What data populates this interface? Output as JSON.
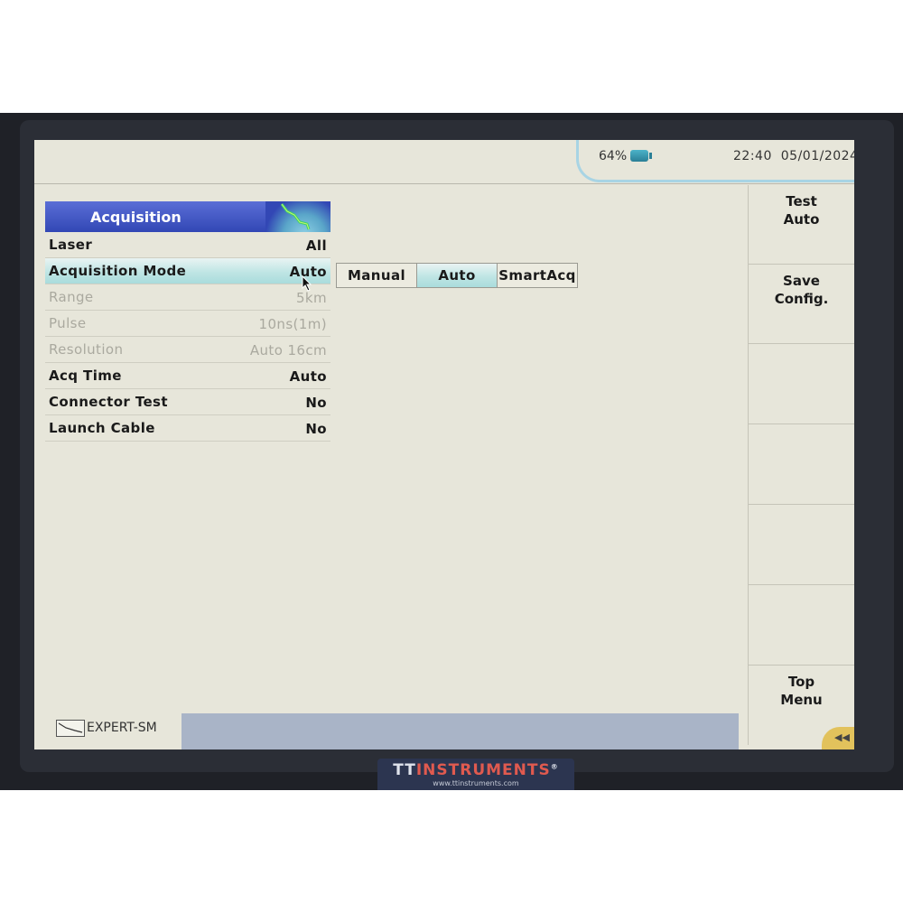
{
  "status": {
    "battery_percent": "64%",
    "time": "22:40",
    "date": "05/01/2024"
  },
  "menu": {
    "title": "Acquisition",
    "rows": [
      {
        "label": "Laser",
        "value": "All",
        "enabled": true,
        "selected": false
      },
      {
        "label": "Acquisition Mode",
        "value": "Auto",
        "enabled": true,
        "selected": true
      },
      {
        "label": "Range",
        "value": "5km",
        "enabled": false,
        "selected": false
      },
      {
        "label": "Pulse",
        "value": "10ns(1m)",
        "enabled": false,
        "selected": false
      },
      {
        "label": "Resolution",
        "value": "Auto 16cm",
        "enabled": false,
        "selected": false
      },
      {
        "label": "Acq Time",
        "value": "Auto",
        "enabled": true,
        "selected": false
      },
      {
        "label": "Connector Test",
        "value": "No",
        "enabled": true,
        "selected": false
      },
      {
        "label": "Launch Cable",
        "value": "No",
        "enabled": true,
        "selected": false
      }
    ]
  },
  "options": {
    "items": [
      "Manual",
      "Auto",
      "SmartAcq"
    ],
    "selected": "Auto"
  },
  "softkeys": {
    "test_line1": "Test",
    "test_line2": "Auto",
    "save_line1": "Save",
    "save_line2": "Config.",
    "top_line1": "Top",
    "top_line2": "Menu"
  },
  "bottom": {
    "mode_label": "EXPERT-SM"
  },
  "brand": {
    "name_prefix": "TT",
    "name_suffix": "INSTRUMENTS",
    "mark": "®",
    "url": "www.ttinstruments.com"
  },
  "colors": {
    "header_blue": "#3247b5",
    "selection_teal": "#a9dcdc",
    "screen_bg": "#e7e6da"
  }
}
